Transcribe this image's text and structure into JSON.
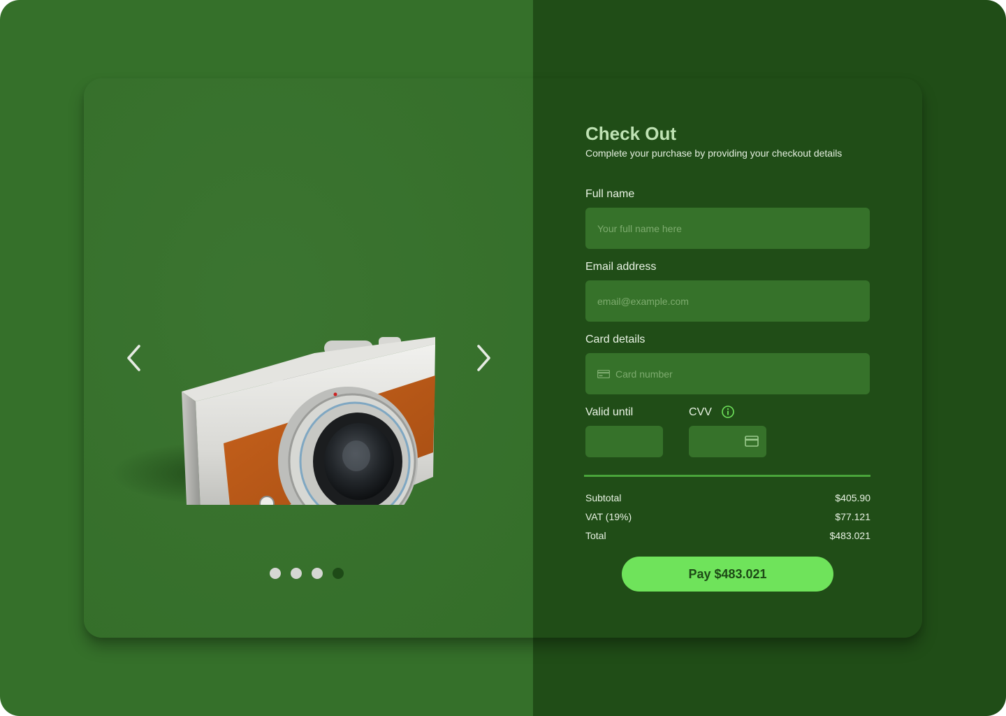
{
  "product": {
    "image_icon": "camera-image",
    "prev_icon": "chevron-left-icon",
    "next_icon": "chevron-right-icon",
    "carousel": {
      "count": 4,
      "active_index": 3
    }
  },
  "checkout": {
    "title": "Check Out",
    "subtitle": "Complete your purchase by providing your checkout details",
    "full_name": {
      "label": "Full name",
      "placeholder": "Your full name here",
      "value": ""
    },
    "email": {
      "label": "Email address",
      "placeholder": "email@example.com",
      "value": ""
    },
    "card": {
      "label": "Card details",
      "placeholder": "Card number",
      "value": ""
    },
    "valid_until": {
      "label": "Valid until",
      "value": ""
    },
    "cvv": {
      "label": "CVV",
      "value": ""
    }
  },
  "summary": {
    "subtotal_label": "Subtotal",
    "subtotal_value": "$405.90",
    "vat_label": "VAT (19%)",
    "vat_value": "$77.121",
    "total_label": "Total",
    "total_value": "$483.021"
  },
  "pay_button_label": "Pay $483.021",
  "colors": {
    "left_panel": "#35702a",
    "right_panel": "#204d17",
    "field": "#36722a",
    "accent": "#6fe35b",
    "divider": "#49a53a"
  }
}
